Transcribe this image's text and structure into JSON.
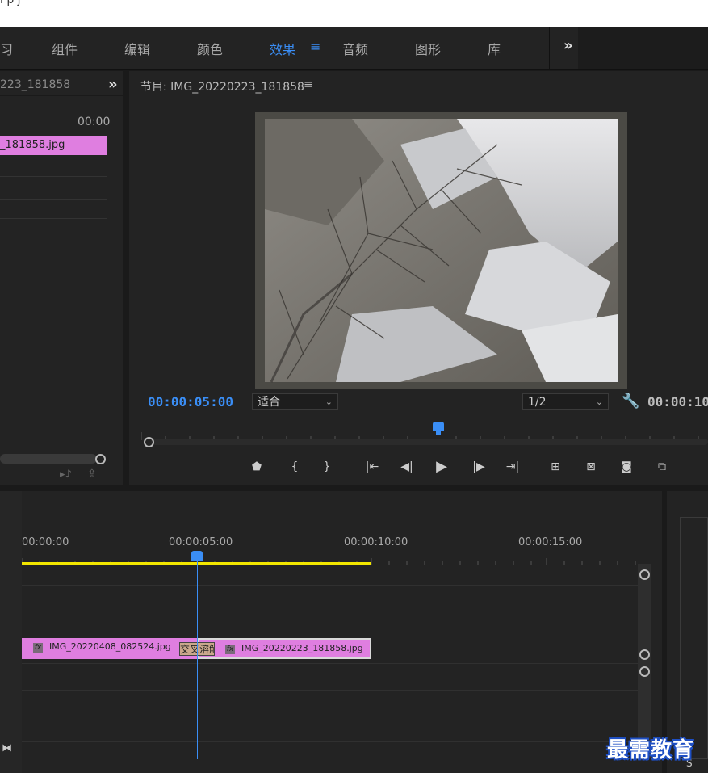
{
  "title_strip": {
    "text": "i p j"
  },
  "workspace": {
    "tabs": [
      {
        "label": "习"
      },
      {
        "label": "组件"
      },
      {
        "label": "编辑"
      },
      {
        "label": "颜色"
      },
      {
        "label": "效果"
      },
      {
        "label": "音频"
      },
      {
        "label": "图形"
      },
      {
        "label": "库"
      }
    ],
    "active_menu_glyph": "≡",
    "more_glyph": "»"
  },
  "source_panel": {
    "title": "223_181858",
    "more_glyph": "»",
    "timecode": "00:00",
    "clip_label": "_181858.jpg"
  },
  "program_panel": {
    "title": "节目: IMG_20220223_181858",
    "menu_glyph": "≡",
    "current_timecode": "00:00:05:00",
    "fit_label": "适合",
    "resolution_label": "1/2",
    "duration_timecode": "00:00:10:"
  },
  "timeline": {
    "ruler_times": [
      "00:00:00",
      "00:00:05:00",
      "00:00:10:00",
      "00:00:15:00"
    ],
    "clip1_label": "IMG_20220408_082524.jpg",
    "clip2_label": "IMG_20220223_181858.jpg",
    "fx_label": "fx",
    "transition_label": "交叉溶解",
    "playhead_fraction": 0.5
  },
  "right_panel": {
    "label": "S"
  },
  "watermark": {
    "text": "最需教育"
  },
  "colors": {
    "accent": "#3a8ef6",
    "clip": "#df7ee0",
    "work_area": "#f2e600",
    "panel_bg": "#232323"
  }
}
